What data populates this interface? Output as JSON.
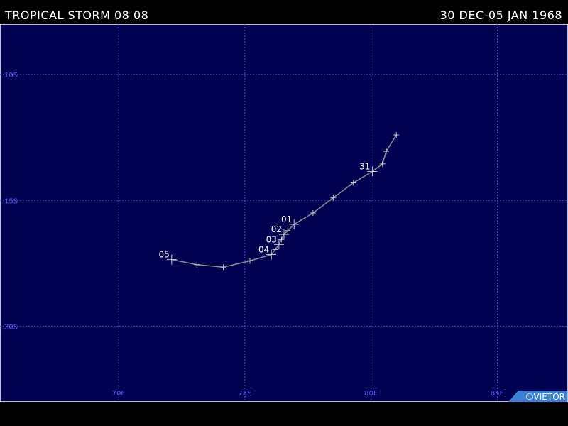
{
  "header": {
    "title": "TROPICAL STORM 08 08",
    "dates": "30 DEC-05 JAN 1968"
  },
  "map": {
    "background_color": "#000050",
    "grid_color": "#4848d8",
    "label_color": "#5a5aff",
    "track_color": "#909090",
    "marker_color": "#c8c8c8",
    "lon_range": [
      65.3,
      87.8
    ],
    "lat_range": [
      -8.0,
      -23.0
    ],
    "lon_lines": [
      {
        "value": 70,
        "label": "70E"
      },
      {
        "value": 75,
        "label": "75E"
      },
      {
        "value": 80,
        "label": "80E"
      },
      {
        "value": 85,
        "label": "85E"
      }
    ],
    "lat_lines": [
      {
        "value": -10,
        "label": "10S"
      },
      {
        "value": -15,
        "label": "15S"
      },
      {
        "value": -20,
        "label": "20S"
      }
    ],
    "track": [
      {
        "lon": 81.0,
        "lat": -12.4
      },
      {
        "lon": 80.6,
        "lat": -13.05
      },
      {
        "lon": 80.45,
        "lat": -13.55
      },
      {
        "lon": 80.05,
        "lat": -13.85
      },
      {
        "lon": 79.3,
        "lat": -14.3
      },
      {
        "lon": 78.5,
        "lat": -14.9
      },
      {
        "lon": 77.7,
        "lat": -15.5
      },
      {
        "lon": 76.95,
        "lat": -15.95
      },
      {
        "lon": 76.7,
        "lat": -16.2
      },
      {
        "lon": 76.55,
        "lat": -16.35
      },
      {
        "lon": 76.45,
        "lat": -16.55
      },
      {
        "lon": 76.35,
        "lat": -16.75
      },
      {
        "lon": 76.2,
        "lat": -16.95
      },
      {
        "lon": 76.05,
        "lat": -17.15
      },
      {
        "lon": 75.2,
        "lat": -17.4
      },
      {
        "lon": 74.15,
        "lat": -17.65
      },
      {
        "lon": 73.1,
        "lat": -17.55
      },
      {
        "lon": 72.1,
        "lat": -17.35
      }
    ],
    "day_labels": [
      {
        "label": "31",
        "lon": 80.05,
        "lat": -13.85
      },
      {
        "label": "01",
        "lon": 76.95,
        "lat": -15.95
      },
      {
        "label": "02",
        "lon": 76.55,
        "lat": -16.35
      },
      {
        "label": "03",
        "lon": 76.35,
        "lat": -16.75
      },
      {
        "label": "04",
        "lon": 76.05,
        "lat": -17.15
      },
      {
        "label": "05",
        "lon": 72.1,
        "lat": -17.35
      }
    ]
  },
  "credit": {
    "text": "©VIETOR",
    "background_color": "#3a7fd8"
  }
}
